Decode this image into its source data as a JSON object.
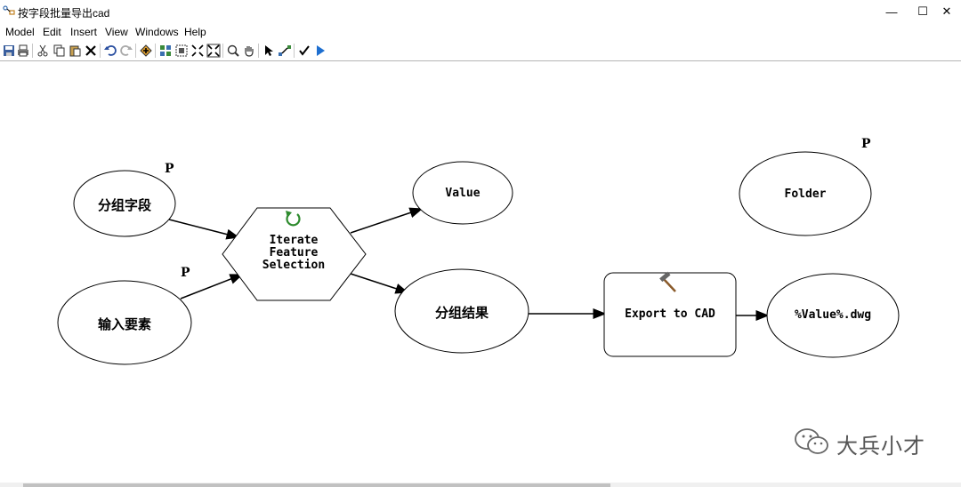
{
  "window": {
    "title": "按字段批量导出cad",
    "minimize_glyph": "—",
    "maximize_glyph": "☐",
    "close_glyph": "✕"
  },
  "menu": [
    "Model",
    "Edit",
    "Insert",
    "View",
    "Windows",
    "Help"
  ],
  "toolbar": {
    "buttons": [
      "save-icon",
      "print-icon",
      "cut-icon",
      "copy-icon",
      "paste-icon",
      "delete-icon",
      "undo-icon",
      "redo-icon",
      "add-data-icon",
      "auto-layout-icon",
      "full-extent-icon",
      "fixed-zoom-in-icon",
      "fixed-zoom-out-icon",
      "zoom-in-icon",
      "pan-icon",
      "select-icon",
      "connect-icon",
      "validate-icon",
      "run-icon"
    ]
  },
  "diagram": {
    "nodes": {
      "group_field": {
        "label": "分组字段",
        "fill": "#ffffff",
        "param": "P"
      },
      "input_features": {
        "label": "输入要素",
        "fill": "#ffffff",
        "param": "P"
      },
      "iterate": {
        "line1": "Iterate",
        "line2": "Feature",
        "line3": "Selection"
      },
      "value": {
        "label": "Value"
      },
      "group_result": {
        "label": "分组结果"
      },
      "export": {
        "label": "Export to CAD"
      },
      "output": {
        "label": "%Value%.dwg"
      },
      "folder": {
        "label": "Folder",
        "param": "P"
      }
    }
  },
  "watermark": {
    "text": "大兵小才"
  },
  "colors": {
    "line": "#000000",
    "iterate_icon": "#2e8b2e",
    "run": "#1e6fd0"
  }
}
